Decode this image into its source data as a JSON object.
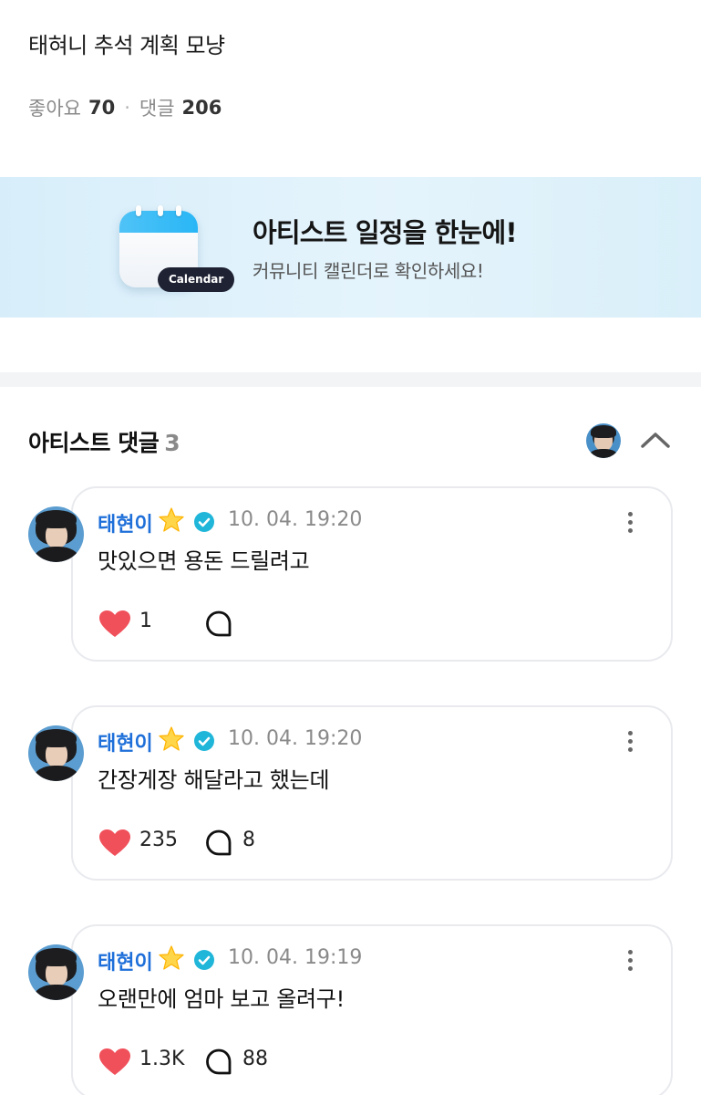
{
  "post": {
    "title": "태혀니 추석 계획 모냥",
    "likes_label": "좋아요",
    "likes": "70",
    "separator": "·",
    "comments_label": "댓글",
    "comments": "206"
  },
  "banner": {
    "badge": "Calendar",
    "headline": "아티스트 일정을 한눈에!",
    "subline": "커뮤니티 캘린더로 확인하세요!"
  },
  "artist_comments": {
    "title": "아티스트 댓글",
    "count": "3",
    "items": [
      {
        "author": "태현이",
        "time": "10. 04. 19:20",
        "text": "맛있으면 용돈 드릴려고",
        "likes": "1",
        "replies": ""
      },
      {
        "author": "태현이",
        "time": "10. 04. 19:20",
        "text": "간장게장 해달라고 했는데",
        "likes": "235",
        "replies": "8"
      },
      {
        "author": "태현이",
        "time": "10. 04. 19:19",
        "text": "오랜만에 엄마 보고 올려구!",
        "likes": "1.3K",
        "replies": "88"
      }
    ]
  },
  "colors": {
    "author": "#1e6fd9",
    "heart": "#f0505a",
    "verified": "#1fb6d9",
    "banner_bg": "#dff1fb"
  },
  "icons": [
    "star-icon",
    "verified-icon",
    "heart-icon",
    "comment-icon",
    "more-icon",
    "chevron-up-icon",
    "calendar-icon"
  ]
}
